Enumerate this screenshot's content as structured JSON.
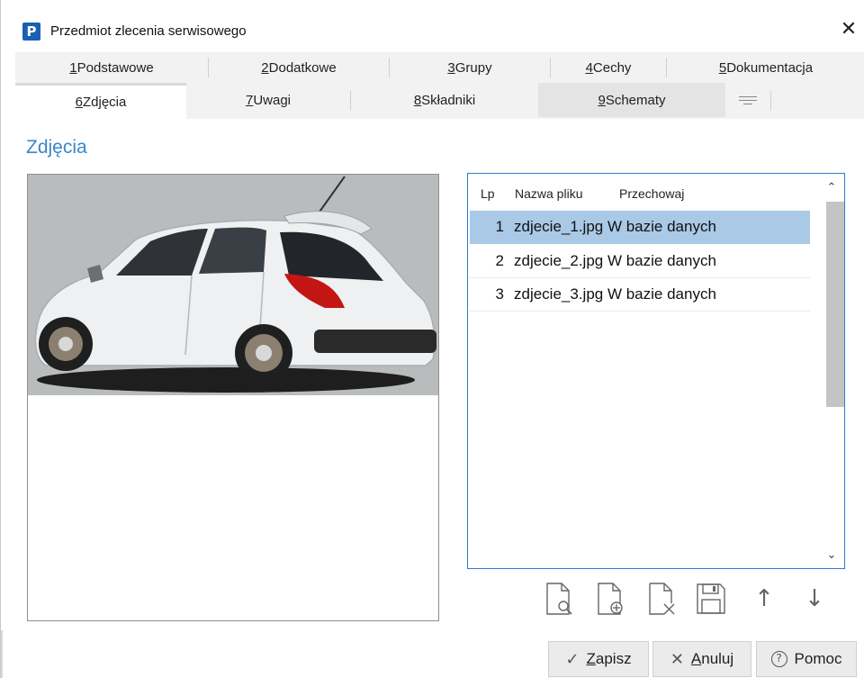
{
  "window": {
    "title": "Przedmiot zlecenia serwisowego",
    "app_icon_letter": "P",
    "close_glyph": "✕"
  },
  "tabs_row1": [
    {
      "key": "1",
      "label": " Podstawowe"
    },
    {
      "key": "2",
      "label": " Dodatkowe"
    },
    {
      "key": "3",
      "label": " Grupy"
    },
    {
      "key": "4",
      "label": " Cechy"
    },
    {
      "key": "5",
      "label": " Dokumentacja"
    }
  ],
  "tabs_row2": [
    {
      "key": "6",
      "label": " Zdjęcia"
    },
    {
      "key": "7",
      "label": " Uwagi"
    },
    {
      "key": "8",
      "label": " Składniki"
    },
    {
      "key": "9",
      "label": " Schematy"
    }
  ],
  "section_title": "Zdjęcia",
  "file_list": {
    "headers": {
      "lp": "Lp",
      "name": "Nazwa pliku",
      "storage": "Przechowaj"
    },
    "rows": [
      {
        "lp": "1",
        "name": "zdjecie_1.jpg W bazie danych"
      },
      {
        "lp": "2",
        "name": "zdjecie_2.jpg W bazie danych"
      },
      {
        "lp": "3",
        "name": "zdjecie_3.jpg W bazie danych"
      }
    ],
    "selected_index": 0,
    "scroll_up_glyph": "⌃",
    "scroll_down_glyph": "⌄"
  },
  "toolbar": {
    "preview_icon": "document-search-icon",
    "add_icon": "document-add-icon",
    "delete_icon": "document-delete-icon",
    "save_icon": "save-icon",
    "up_glyph": "↑",
    "down_glyph": "↓"
  },
  "buttons": {
    "save": {
      "glyph": "✓",
      "ul": "Z",
      "rest": "apisz"
    },
    "cancel": {
      "glyph": "✕",
      "ul": "A",
      "rest": "nuluj"
    },
    "help": {
      "glyph": "?",
      "label": "Pomoc"
    }
  },
  "colors": {
    "accent_blue": "#3a87c8",
    "selected_row": "#a9c9e6",
    "list_border": "#2c7bd2",
    "app_icon": "#1a5fb4"
  }
}
